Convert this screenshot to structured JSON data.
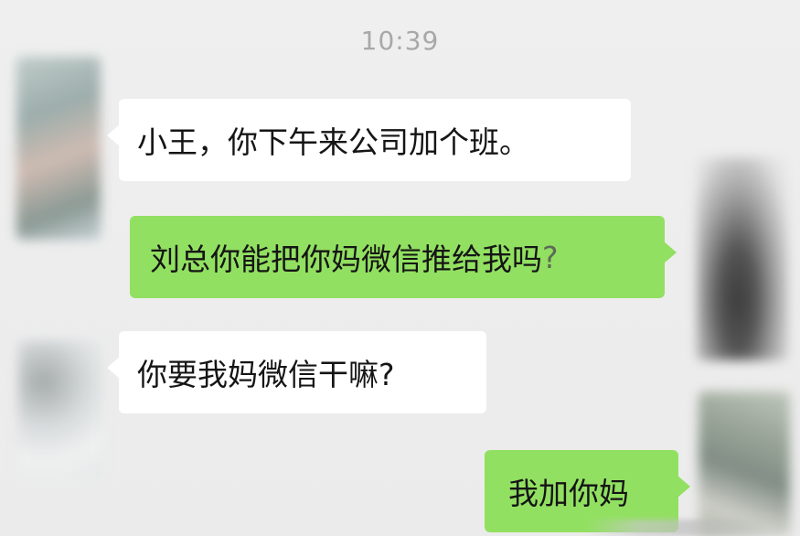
{
  "chat": {
    "timestamp": "10:39",
    "messages": [
      {
        "side": "left",
        "text": "小王，你下午来公司加个班。"
      },
      {
        "side": "right",
        "text": "刘总你能把你妈微信推给我吗",
        "suffix": "?"
      },
      {
        "side": "left",
        "text": "你要我妈微信干嘛?"
      },
      {
        "side": "right",
        "text": "我加你妈"
      }
    ]
  },
  "colors": {
    "background": "#ececec",
    "incoming_bubble": "#ffffff",
    "outgoing_bubble": "#92e061",
    "timestamp": "#a8a8a8"
  }
}
